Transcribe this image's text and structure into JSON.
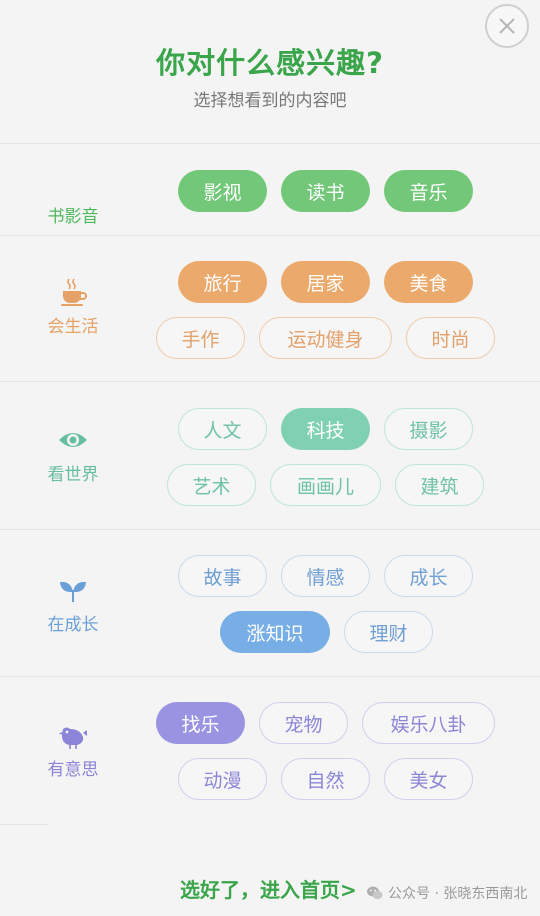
{
  "header": {
    "title": "你对什么感兴趣?",
    "subtitle": "选择想看到的内容吧",
    "close_icon": "close-icon"
  },
  "sections": [
    {
      "category": "书影音",
      "color": "#72c878",
      "tags": [
        {
          "label": "影视",
          "selected": true
        },
        {
          "label": "读书",
          "selected": true
        },
        {
          "label": "音乐",
          "selected": true
        }
      ]
    },
    {
      "category": "会生活",
      "icon": "coffee-cup-icon",
      "color": "#eba96b",
      "tags": [
        {
          "label": "旅行",
          "selected": true
        },
        {
          "label": "居家",
          "selected": true
        },
        {
          "label": "美食",
          "selected": true
        },
        {
          "label": "手作",
          "selected": false
        },
        {
          "label": "运动健身",
          "selected": false
        },
        {
          "label": "时尚",
          "selected": false
        }
      ]
    },
    {
      "category": "看世界",
      "icon": "eye-icon",
      "color": "#7fd1b2",
      "tags": [
        {
          "label": "人文",
          "selected": false
        },
        {
          "label": "科技",
          "selected": true
        },
        {
          "label": "摄影",
          "selected": false
        },
        {
          "label": "艺术",
          "selected": false
        },
        {
          "label": "画画儿",
          "selected": false
        },
        {
          "label": "建筑",
          "selected": false
        }
      ]
    },
    {
      "category": "在成长",
      "icon": "sprout-icon",
      "color": "#78aee6",
      "tags": [
        {
          "label": "故事",
          "selected": false
        },
        {
          "label": "情感",
          "selected": false
        },
        {
          "label": "成长",
          "selected": false
        },
        {
          "label": "涨知识",
          "selected": true
        },
        {
          "label": "理财",
          "selected": false
        }
      ]
    },
    {
      "category": "有意思",
      "icon": "bird-icon",
      "color": "#9a93e2",
      "tags": [
        {
          "label": "找乐",
          "selected": true
        },
        {
          "label": "宠物",
          "selected": false
        },
        {
          "label": "娱乐八卦",
          "selected": false
        },
        {
          "label": "动漫",
          "selected": false
        },
        {
          "label": "自然",
          "selected": false
        },
        {
          "label": "美女",
          "selected": false
        }
      ]
    }
  ],
  "footer": {
    "enter_link": "选好了，进入首页>",
    "watermark": "公众号 · 张晓东西南北",
    "watermark_icon": "wechat-icon"
  }
}
